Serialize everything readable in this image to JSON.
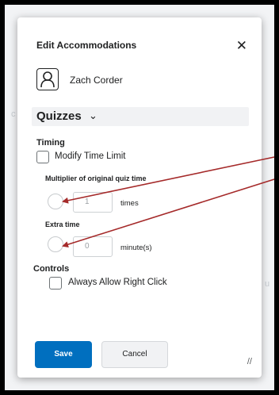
{
  "dialog": {
    "title": "Edit Accommodations",
    "close_icon": "close-icon",
    "user": {
      "name": "Zach Corder",
      "avatar_icon": "user-avatar-icon"
    },
    "section": {
      "title": "Quizzes",
      "chevron": "⌄",
      "chevron_icon": "chevron-down-icon"
    },
    "timing": {
      "heading": "Timing",
      "modify_label": "Modify Time Limit",
      "multiplier_label": "Multiplier of original quiz time",
      "multiplier_value": "1",
      "multiplier_unit": "times",
      "extra_label": "Extra time",
      "extra_value": "0",
      "extra_unit": "minute(s)"
    },
    "controls": {
      "heading": "Controls",
      "right_click_label": "Always Allow Right Click"
    },
    "buttons": {
      "save": "Save",
      "cancel": "Cancel"
    },
    "resize_icon": "resize-handle-icon"
  },
  "annotation": {
    "arrow_color": "#a52a2a"
  }
}
